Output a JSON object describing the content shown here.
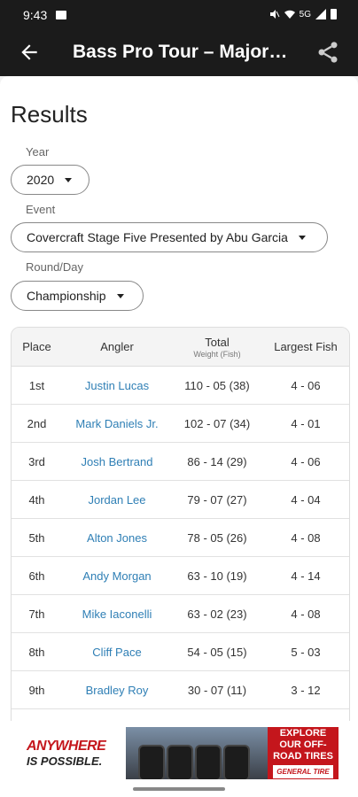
{
  "status_bar": {
    "time": "9:43",
    "network": "5G"
  },
  "app_bar": {
    "title": "Bass Pro Tour – Major…"
  },
  "page": {
    "title": "Results"
  },
  "filters": {
    "year_label": "Year",
    "year_value": "2020",
    "event_label": "Event",
    "event_value": "Covercraft Stage Five Presented by Abu Garcia",
    "round_label": "Round/Day",
    "round_value": "Championship"
  },
  "table": {
    "headers": {
      "place": "Place",
      "angler": "Angler",
      "total": "Total",
      "total_sub": "Weight (Fish)",
      "largest": "Largest Fish"
    },
    "rows": [
      {
        "place": "1st",
        "angler": "Justin Lucas",
        "total": "110 - 05 (38)",
        "largest": "4 - 06"
      },
      {
        "place": "2nd",
        "angler": "Mark Daniels Jr.",
        "total": "102 - 07 (34)",
        "largest": "4 - 01"
      },
      {
        "place": "3rd",
        "angler": "Josh Bertrand",
        "total": "86 - 14 (29)",
        "largest": "4 - 06"
      },
      {
        "place": "4th",
        "angler": "Jordan Lee",
        "total": "79 - 07 (27)",
        "largest": "4 - 04"
      },
      {
        "place": "5th",
        "angler": "Alton Jones",
        "total": "78 - 05 (26)",
        "largest": "4 - 08"
      },
      {
        "place": "6th",
        "angler": "Andy Morgan",
        "total": "63 - 10 (19)",
        "largest": "4 - 14"
      },
      {
        "place": "7th",
        "angler": "Mike Iaconelli",
        "total": "63 - 02 (23)",
        "largest": "4 - 08"
      },
      {
        "place": "8th",
        "angler": "Cliff Pace",
        "total": "54 - 05 (15)",
        "largest": "5 - 03"
      },
      {
        "place": "9th",
        "angler": "Bradley Roy",
        "total": "30 - 07 (11)",
        "largest": "3 - 12"
      }
    ]
  },
  "ad": {
    "headline": "ANYWHERE",
    "subline": "IS POSSIBLE.",
    "cta": "EXPLORE OUR OFF-ROAD TIRES",
    "brand": "GENERAL TIRE"
  },
  "colors": {
    "accent_link": "#2f7fb5",
    "appbar": "#1b1b1b",
    "ad_red": "#c4161c"
  }
}
